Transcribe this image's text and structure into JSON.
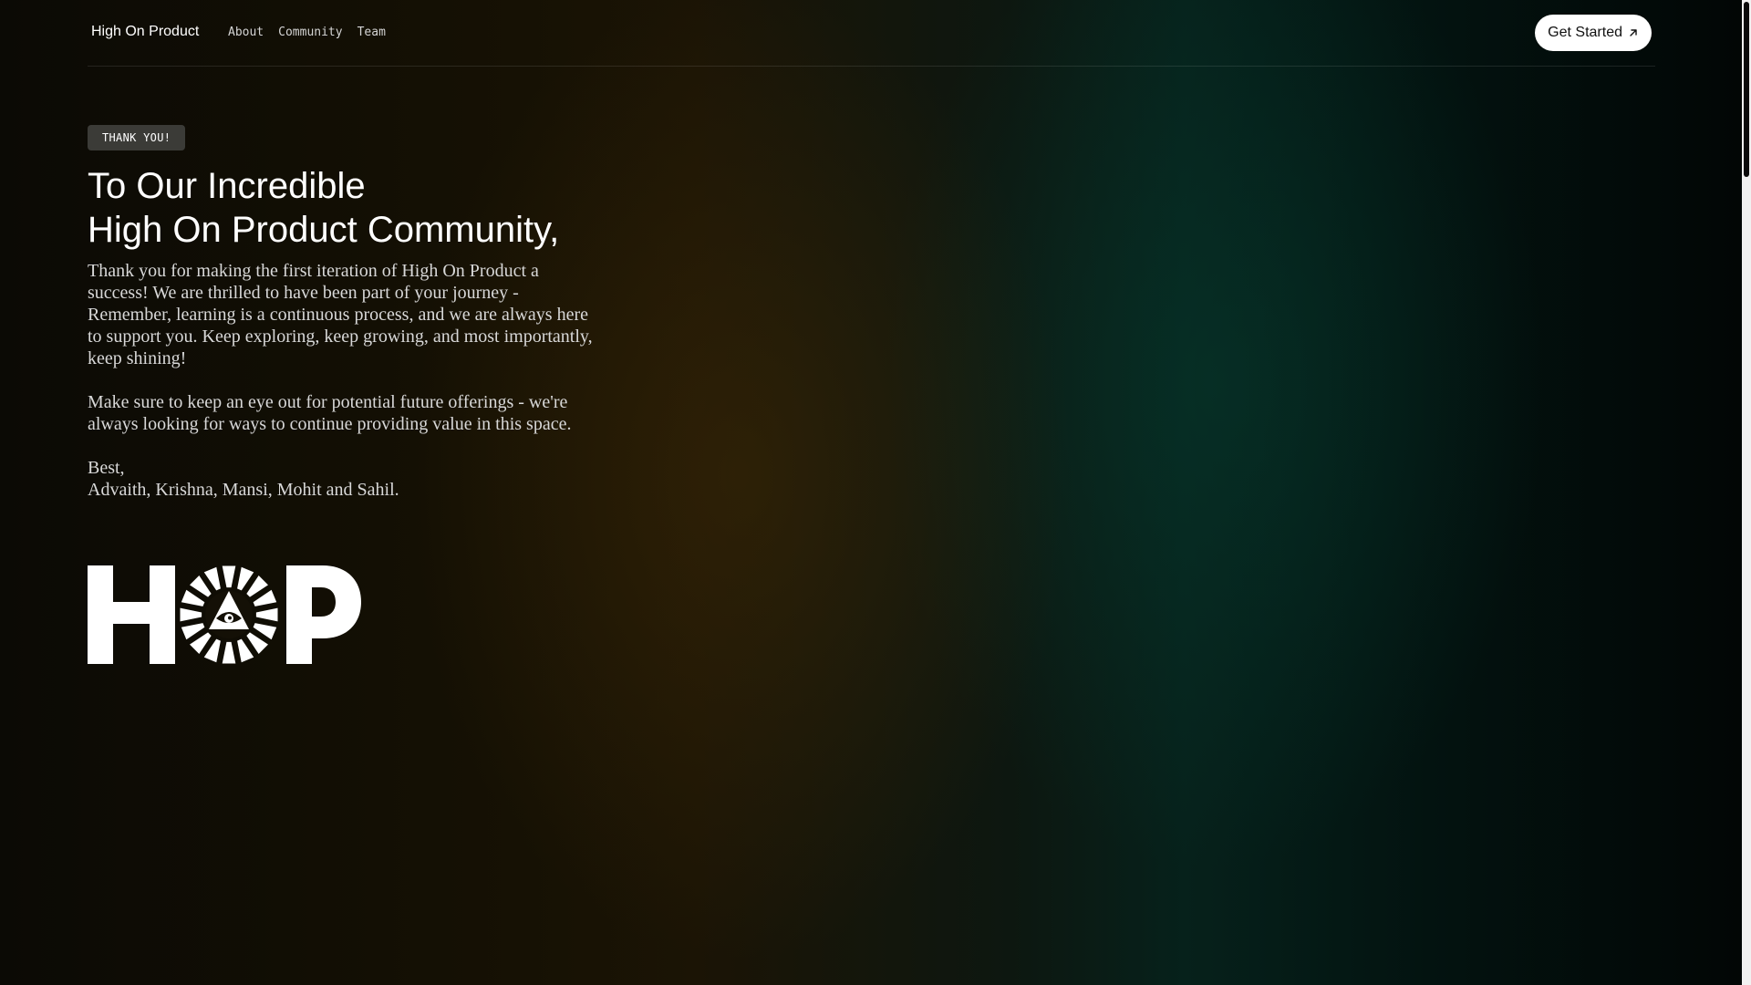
{
  "header": {
    "brand": "High On Product",
    "nav": [
      "About",
      "Community",
      "Team"
    ],
    "cta_label": "Get Started",
    "cta_icon": "arrow-up-right-icon"
  },
  "hero": {
    "badge": "THANK YOU!",
    "title_line1": "To Our Incredible",
    "title_line2": "High On Product Community,",
    "paragraph1": "Thank you for making the first iteration of High On Product a success! We are thrilled to have been part of your journey - Remember, learning is a continuous process, and we are always here to support you. Keep exploring, keep growing, and most importantly, keep shining!",
    "paragraph2": "Make sure to keep an eye out for potential future offerings - we're always looking for ways to continue providing value in this space.",
    "signoff": "Best,",
    "signatories": "Advaith, Krishna, Mansi, Mohit and Sahil."
  },
  "logo": {
    "text": "HOP",
    "icon": "eye-in-triangle-sunburst-icon",
    "color": "#ffffff"
  },
  "colors": {
    "background_left": "#0b0a05",
    "background_amber": "#1b1405",
    "background_teal": "#06211b",
    "button_bg": "#ffffff",
    "badge_bg": "#3b3b37"
  }
}
